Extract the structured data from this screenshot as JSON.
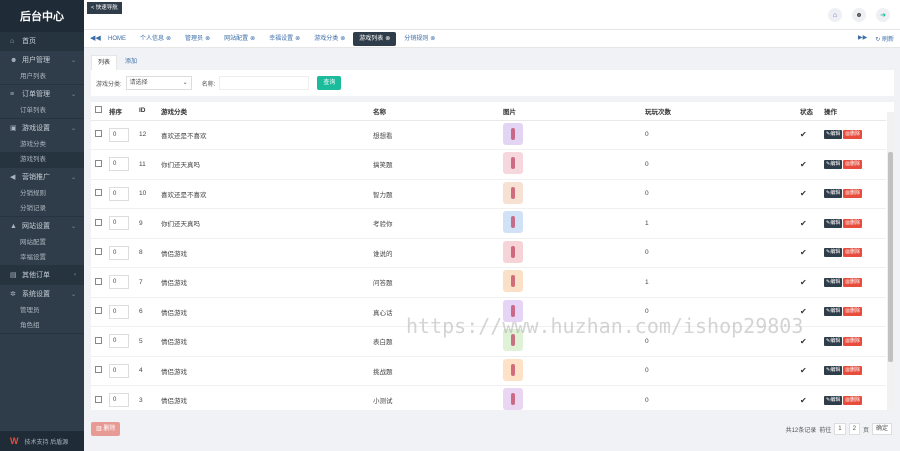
{
  "sidebar": {
    "brand": "后台中心",
    "groups": [
      {
        "label": "首页",
        "icon": "home-icon",
        "glyph": "⌂",
        "subs": []
      },
      {
        "label": "用户管理",
        "icon": "user-icon",
        "glyph": "☻",
        "subs": [
          "用户列表"
        ]
      },
      {
        "label": "订单管理",
        "icon": "list-icon",
        "glyph": "≡",
        "subs": [
          "订单列表"
        ]
      },
      {
        "label": "游戏设置",
        "icon": "game-icon",
        "glyph": "▣",
        "subs": [
          "游戏分类",
          "游戏列表"
        ]
      },
      {
        "label": "营销推广",
        "icon": "megaphone-icon",
        "glyph": "◀",
        "subs": [
          "分销规则",
          "分销记录"
        ]
      },
      {
        "label": "网站设置",
        "icon": "site-icon",
        "glyph": "▲",
        "subs": [
          "网站配置",
          "幸福设置"
        ]
      },
      {
        "label": "其他订单",
        "icon": "order-icon",
        "glyph": "▤",
        "subs": []
      },
      {
        "label": "系统设置",
        "icon": "settings-icon",
        "glyph": "✲",
        "subs": [
          "管理员",
          "角色组"
        ]
      }
    ],
    "footer": "技术支持 后盾源"
  },
  "topbar": {
    "back": "< 快速导航"
  },
  "tabs": [
    "HOME",
    "个人信息",
    "管理员",
    "网站配置",
    "幸福设置",
    "游戏分类",
    "游戏列表",
    "分销规则"
  ],
  "active_tab_index": 6,
  "tabs_right": {
    "refresh": "刷新"
  },
  "subtabs": [
    "列表",
    "添加"
  ],
  "filter": {
    "category_label": "游戏分类:",
    "category_value": "请选择",
    "name_label": "名称:",
    "name_placeholder": "",
    "search_button": "查询"
  },
  "table": {
    "headers": [
      "排序",
      "ID",
      "游戏分类",
      "名称",
      "图片",
      "玩玩次数",
      "状态",
      "操作"
    ],
    "edit_label": "编辑",
    "delete_label": "删除",
    "rows": [
      {
        "sort": "0",
        "id": "12",
        "category": "喜欢还是不喜欢",
        "name": "想想看",
        "plays": "0",
        "color": "#e2d4f2"
      },
      {
        "sort": "0",
        "id": "11",
        "category": "你们还天真吗",
        "name": "搞笑题",
        "plays": "0",
        "color": "#f6d7dd"
      },
      {
        "sort": "0",
        "id": "10",
        "category": "喜欢还是不喜欢",
        "name": "智力题",
        "plays": "0",
        "color": "#f7e1d2"
      },
      {
        "sort": "0",
        "id": "9",
        "category": "你们还天真吗",
        "name": "考验你",
        "plays": "1",
        "color": "#d2e2f6"
      },
      {
        "sort": "0",
        "id": "8",
        "category": "情侣游戏",
        "name": "谁说的",
        "plays": "0",
        "color": "#f6d3d6"
      },
      {
        "sort": "0",
        "id": "7",
        "category": "情侣游戏",
        "name": "问答题",
        "plays": "1",
        "color": "#fae0c6"
      },
      {
        "sort": "0",
        "id": "6",
        "category": "情侣游戏",
        "name": "真心话",
        "plays": "0",
        "color": "#e6d4f6"
      },
      {
        "sort": "0",
        "id": "5",
        "category": "情侣游戏",
        "name": "表白题",
        "plays": "0",
        "color": "#dff2d6"
      },
      {
        "sort": "0",
        "id": "4",
        "category": "情侣游戏",
        "name": "挑战题",
        "plays": "0",
        "color": "#fde2c8"
      },
      {
        "sort": "0",
        "id": "3",
        "category": "情侣游戏",
        "name": "小测试",
        "plays": "0",
        "color": "#ead6f2"
      }
    ]
  },
  "bottom": {
    "delete_button": "删除",
    "total": "共12条记录",
    "goto": "前往",
    "page": "1",
    "pages": "2",
    "unit": "页",
    "confirm": "确定"
  },
  "watermark": "https://www.huzhan.com/ishop29803"
}
